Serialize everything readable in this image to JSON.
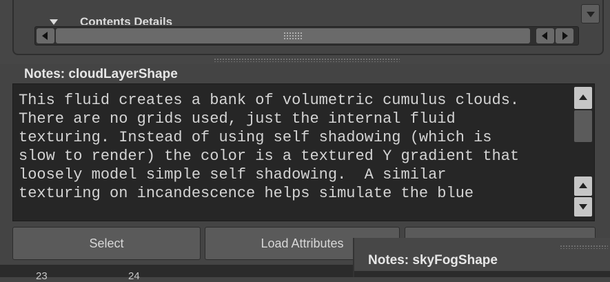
{
  "top_section": {
    "header_label": "Contents Details"
  },
  "notes": {
    "title": "Notes: cloudLayerShape",
    "text": "This fluid creates a bank of volumetric cumulus clouds.\nThere are no grids used, just the internal fluid\ntexturing. Instead of using self shadowing (which is\nslow to render) the color is a textured Y gradient that\nloosely model simple self shadowing.  A similar\ntexturing on incandescence helps simulate the blue"
  },
  "buttons": {
    "select": "Select",
    "load_attributes": "Load Attributes",
    "third": ""
  },
  "bottom_numbers": [
    "23",
    "24"
  ],
  "overlay_panel": {
    "title": "Notes: skyFogShape"
  },
  "icons": {
    "collapse_triangle": "triangle-down-icon",
    "scroll_left": "arrow-left-icon",
    "scroll_right": "arrow-right-icon",
    "scroll_up": "arrow-up-icon",
    "scroll_down": "arrow-down-icon"
  },
  "colors": {
    "panel_bg": "#444444",
    "text_area_bg": "#262626",
    "button_bg": "#5a5a5a",
    "text": "#d4d4d4"
  }
}
